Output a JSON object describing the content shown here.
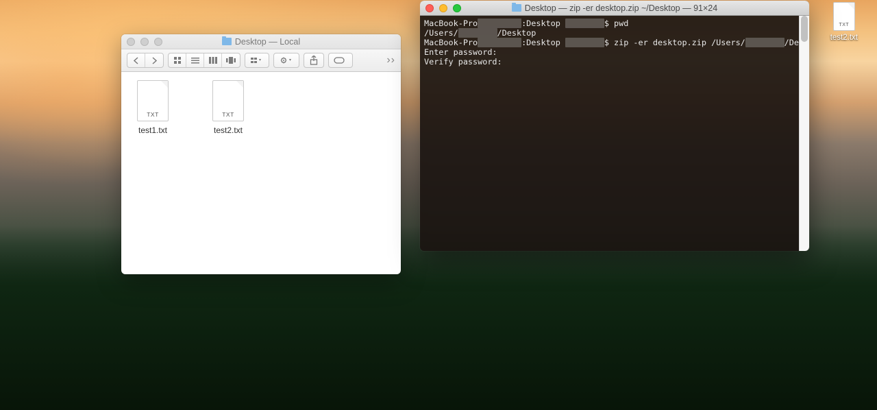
{
  "finder": {
    "title": "Desktop — Local",
    "toolbar": {
      "back": "‹",
      "forward": "›",
      "view_icon": "icon",
      "view_list": "list",
      "view_column": "column",
      "view_gallery": "gallery",
      "arrange": "arrange",
      "action": "action",
      "share": "share",
      "tags": "tags",
      "overflow": "››"
    },
    "files": [
      {
        "name": "test1.txt",
        "ext": "TXT"
      },
      {
        "name": "test2.txt",
        "ext": "TXT"
      }
    ]
  },
  "terminal": {
    "title": "Desktop — zip -er desktop.zip ~/Desktop — 91×24",
    "lines": {
      "l0_pre": "MacBook-Pro",
      "l0_mid": ":Desktop ",
      "l0_cmd": "$ pwd",
      "l1": "/Users/",
      "l1_post": "/Desktop",
      "l2_pre": "MacBook-Pro",
      "l2_mid": ":Desktop ",
      "l2_cmd": "$ zip -er desktop.zip /Users/",
      "l2_post": "/Desktop/",
      "l3": "Enter password:",
      "l4": "Verify password:"
    }
  },
  "desktop": {
    "file": {
      "name": "test2.txt",
      "ext": "TXT"
    }
  },
  "colors": {
    "traffic_red": "#ff5f57",
    "traffic_yellow": "#ffbd2e",
    "traffic_green": "#28c840"
  }
}
